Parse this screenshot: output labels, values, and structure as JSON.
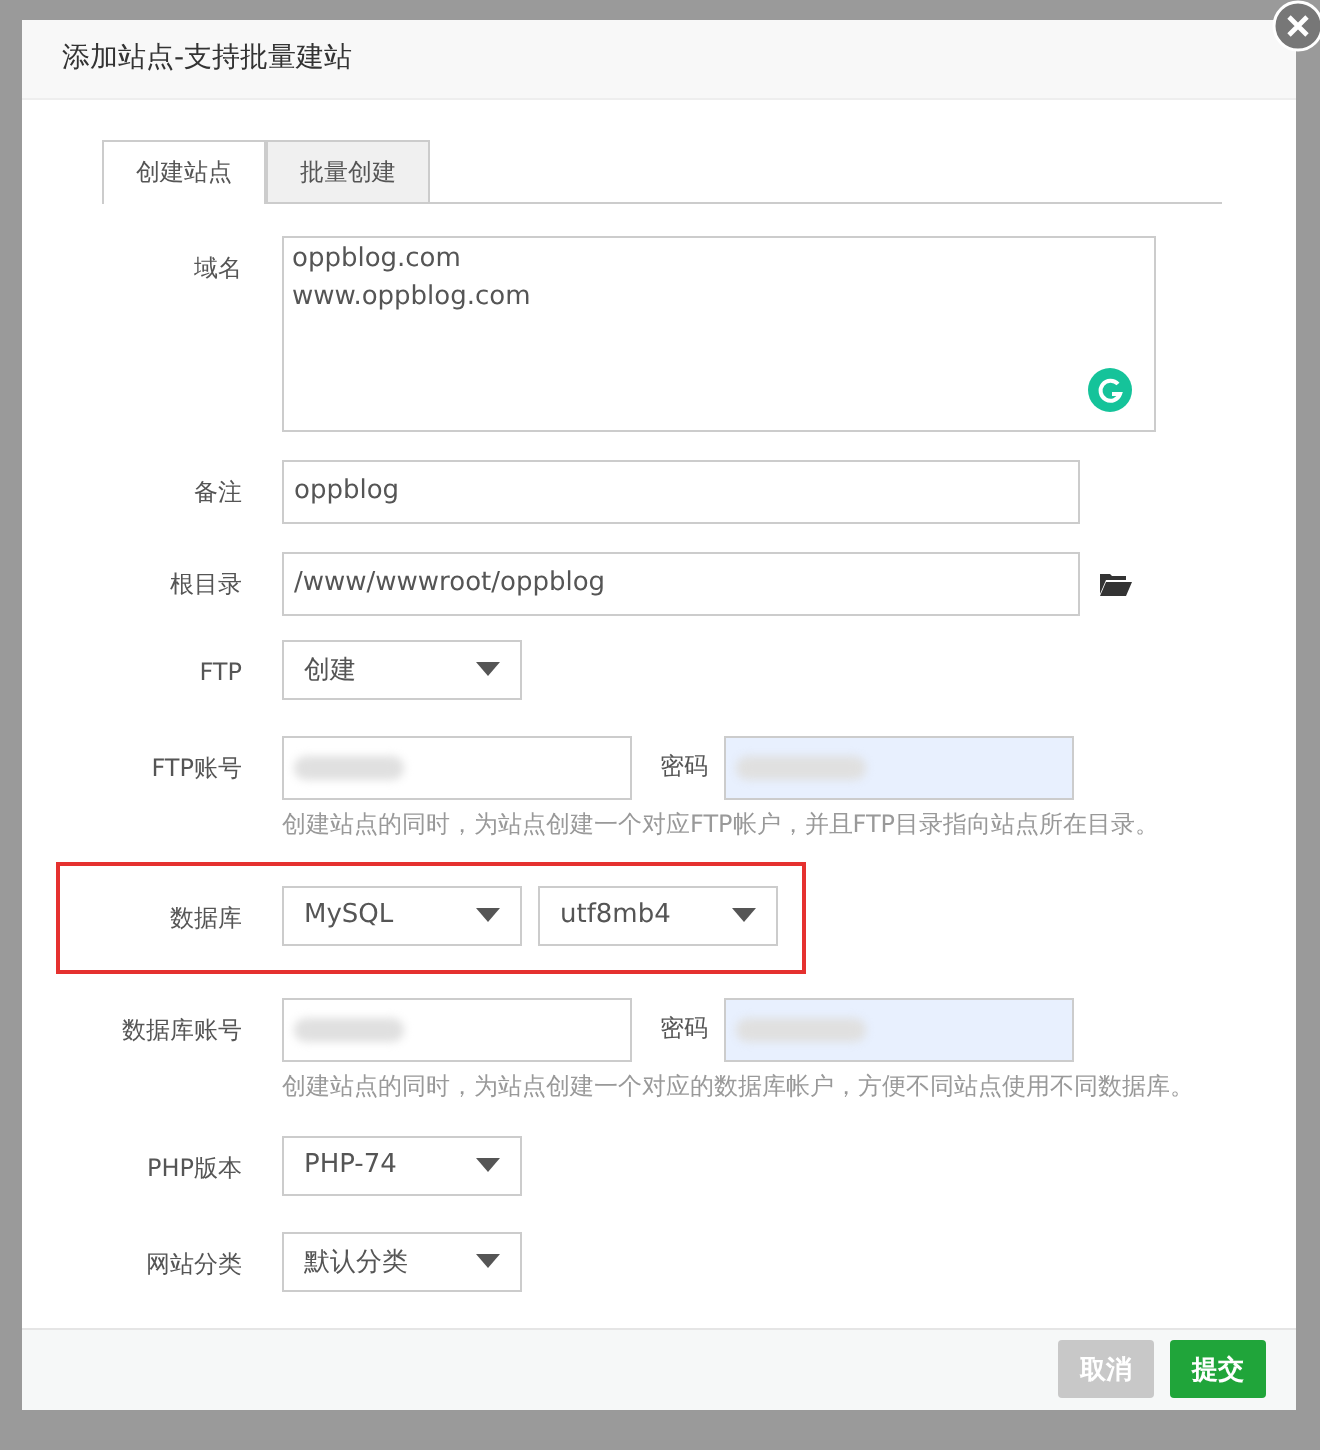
{
  "dialog": {
    "title": "添加站点-支持批量建站"
  },
  "tabs": [
    {
      "label": "创建站点",
      "selected": true
    },
    {
      "label": "批量创建",
      "selected": false
    }
  ],
  "rows": [
    {
      "kind": "textarea",
      "label": "域名",
      "lines": [
        "oppblog.com",
        "www.oppblog.com"
      ]
    },
    {
      "kind": "input",
      "label": "备注",
      "value": "oppblog"
    },
    {
      "kind": "path",
      "label": "根目录",
      "value": "/www/wwwroot/oppblog"
    },
    {
      "kind": "select",
      "label": "FTP",
      "options": [
        "创建"
      ]
    },
    {
      "kind": "account",
      "label": "FTP账号",
      "password_label": "密码",
      "hint": "创建站点的同时，为站点创建一个对应FTP帐户，并且FTP目录指向站点所在目录。"
    },
    {
      "kind": "select",
      "label": "数据库",
      "options": [
        "MySQL",
        "utf8mb4"
      ],
      "highlighted": true
    },
    {
      "kind": "account",
      "label": "数据库账号",
      "password_label": "密码",
      "hint": "创建站点的同时，为站点创建一个对应的数据库帐户，方便不同站点使用不同数据库。"
    },
    {
      "kind": "select",
      "label": "PHP版本",
      "options": [
        "PHP-74"
      ]
    },
    {
      "kind": "select",
      "label": "网站分类",
      "options": [
        "默认分类"
      ]
    }
  ],
  "buttons": [
    {
      "label": "取消",
      "disabled": true
    },
    {
      "label": "提交",
      "disabled": false
    }
  ]
}
